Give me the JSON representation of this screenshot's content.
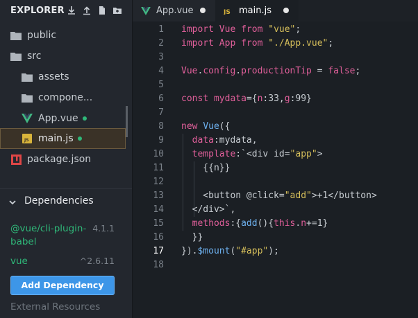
{
  "sidebar": {
    "title": "EXPLORER",
    "header_icons": [
      "download-icon",
      "upload-icon",
      "new-file-icon",
      "new-folder-icon"
    ],
    "tree": [
      {
        "label": "public",
        "icon": "folder-icon"
      },
      {
        "label": "src",
        "icon": "folder-icon"
      },
      {
        "label": "assets",
        "icon": "folder-icon"
      },
      {
        "label": "compone...",
        "icon": "folder-icon"
      },
      {
        "label": "App.vue",
        "icon": "vue-icon",
        "modified": true
      },
      {
        "label": "main.js",
        "icon": "js-icon",
        "modified": true,
        "active": true
      },
      {
        "label": "package.json",
        "icon": "npm-icon"
      }
    ],
    "dependencies": {
      "title": "Dependencies",
      "items": [
        {
          "name_line1": "@vue/cli-plugin-",
          "name_line2": "babel",
          "version": "4.1.1"
        },
        {
          "name_line1": "vue",
          "name_line2": "",
          "version": "^2.6.11"
        }
      ],
      "add_button": "Add Dependency",
      "external_resources": "External Resources"
    }
  },
  "tabs": [
    {
      "label": "App.vue",
      "icon": "vue-icon",
      "modified": true
    },
    {
      "label": "main.js",
      "icon": "js-icon",
      "modified": true,
      "active": true
    }
  ],
  "editor": {
    "current_line": 17,
    "line_numbers": [
      "1",
      "2",
      "3",
      "4",
      "5",
      "6",
      "7",
      "8",
      "9",
      "10",
      "11",
      "12",
      "13",
      "14",
      "15",
      "16",
      "17",
      "18"
    ]
  },
  "colors": {
    "accent": "#3d96e8",
    "modified_dot": "#2fb879",
    "keyword": "#e05f9a",
    "string": "#d4bd5a",
    "function": "#6db0ee"
  }
}
